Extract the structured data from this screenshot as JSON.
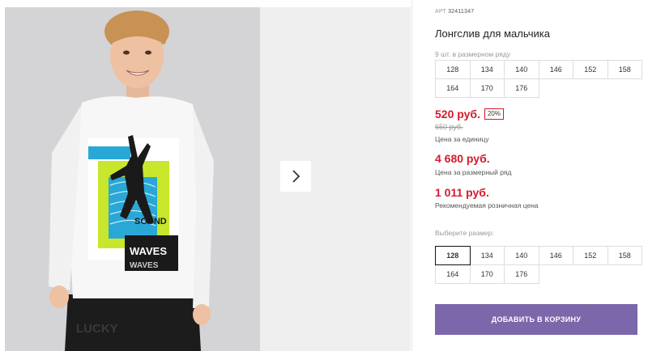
{
  "gallery": {
    "next_label": "›",
    "shirt_print": {
      "word_top": "SOUND",
      "word_middle": "WAVES",
      "word_bottom": "WAVES"
    },
    "pants_print": "LUCKY"
  },
  "product": {
    "article_label": "АРТ",
    "article_value": "32411347",
    "title": "Лонгслив для мальчика",
    "size_row_note": "9 шт. в размерном ряду",
    "size_row": [
      "128",
      "134",
      "140",
      "146",
      "152",
      "158",
      "164",
      "170",
      "176"
    ],
    "price": "520 руб.",
    "discount": "20%",
    "old_price": "650 руб.",
    "price_unit_label": "Цена за единицу",
    "price_row_total": "4 680 руб.",
    "price_row_label": "Цена за размерный ряд",
    "retail_price": "1 011 руб.",
    "retail_label": "Рекомендуемая розничная цена",
    "choose_size_label": "Выберите размер:",
    "choose_sizes": [
      "128",
      "134",
      "140",
      "146",
      "152",
      "158",
      "164",
      "170",
      "176"
    ],
    "selected_size": "128",
    "add_to_cart": "ДОБАВИТЬ В КОРЗИНУ"
  },
  "colors": {
    "accent": "#7b67a9",
    "price_red": "#d51a2c",
    "photo_bg": "#d4d4d6",
    "print_lime": "#c8e62c",
    "print_blue": "#29a8d8"
  }
}
